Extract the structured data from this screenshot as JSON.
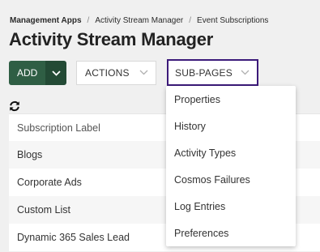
{
  "breadcrumb": [
    "Management Apps",
    "Activity Stream Manager",
    "Event Subscriptions"
  ],
  "page_title": "Activity Stream Manager",
  "toolbar": {
    "add_label": "ADD",
    "actions_label": "ACTIONS",
    "subpages_label": "SUB-PAGES"
  },
  "table": {
    "header": "Subscription Label",
    "rows": [
      "Blogs",
      "Corporate Ads",
      "Custom List",
      "Dynamic 365 Sales Lead"
    ]
  },
  "subpages_menu": {
    "items": [
      "Properties",
      "History",
      "Activity Types",
      "Cosmos Failures",
      "Log Entries",
      "Preferences"
    ]
  },
  "colors": {
    "add_button": "#2f5e44",
    "focus_border": "#3c1a7a"
  }
}
